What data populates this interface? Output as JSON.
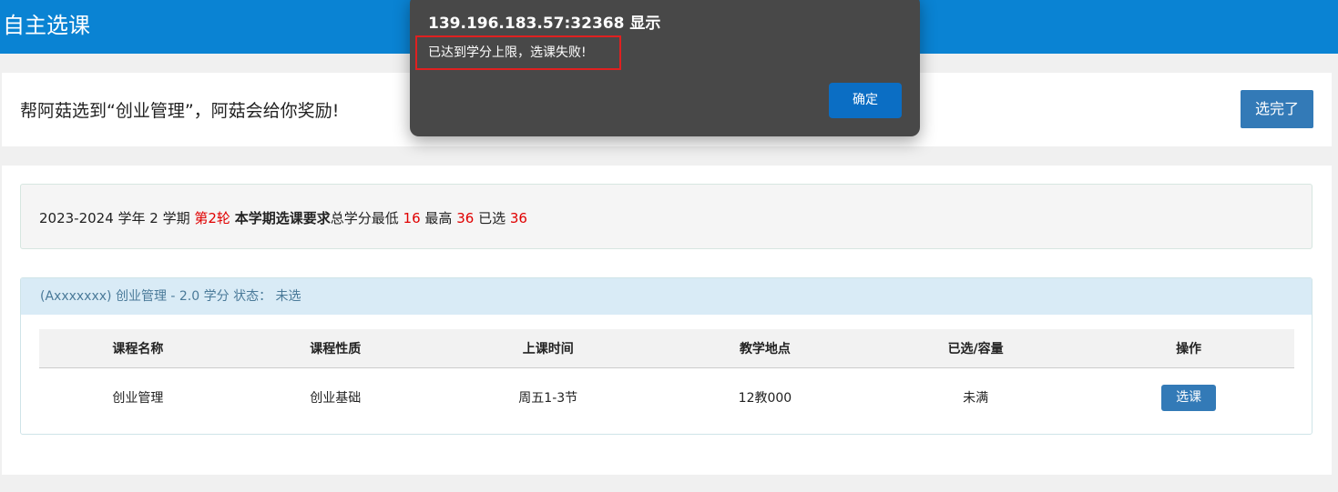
{
  "header": {
    "title": "自主选课"
  },
  "intro": {
    "text": "帮阿菇选到“创业管理”，阿菇会给你奖励!",
    "done_button": "选完了"
  },
  "summary": {
    "year": "2023-2024 学年 2 学期",
    "round": "第2轮",
    "req_label": "本学期选课要求",
    "total_label": "总学分最低",
    "min": "16",
    "max_label": "最高",
    "max": "36",
    "selected_label": "已选",
    "selected": "36"
  },
  "course": {
    "header": "(Axxxxxxx) 创业管理 - 2.0 学分 状态：  未选",
    "columns": [
      "课程名称",
      "课程性质",
      "上课时间",
      "教学地点",
      "已选/容量",
      "操作"
    ],
    "row": {
      "name": "创业管理",
      "type": "创业基础",
      "time": "周五1-3节",
      "location": "12教000",
      "capacity": "未满",
      "action": "选课"
    }
  },
  "dialog": {
    "title": "139.196.183.57:32368 显示",
    "message": "已达到学分上限，选课失败!",
    "ok": "确定"
  }
}
